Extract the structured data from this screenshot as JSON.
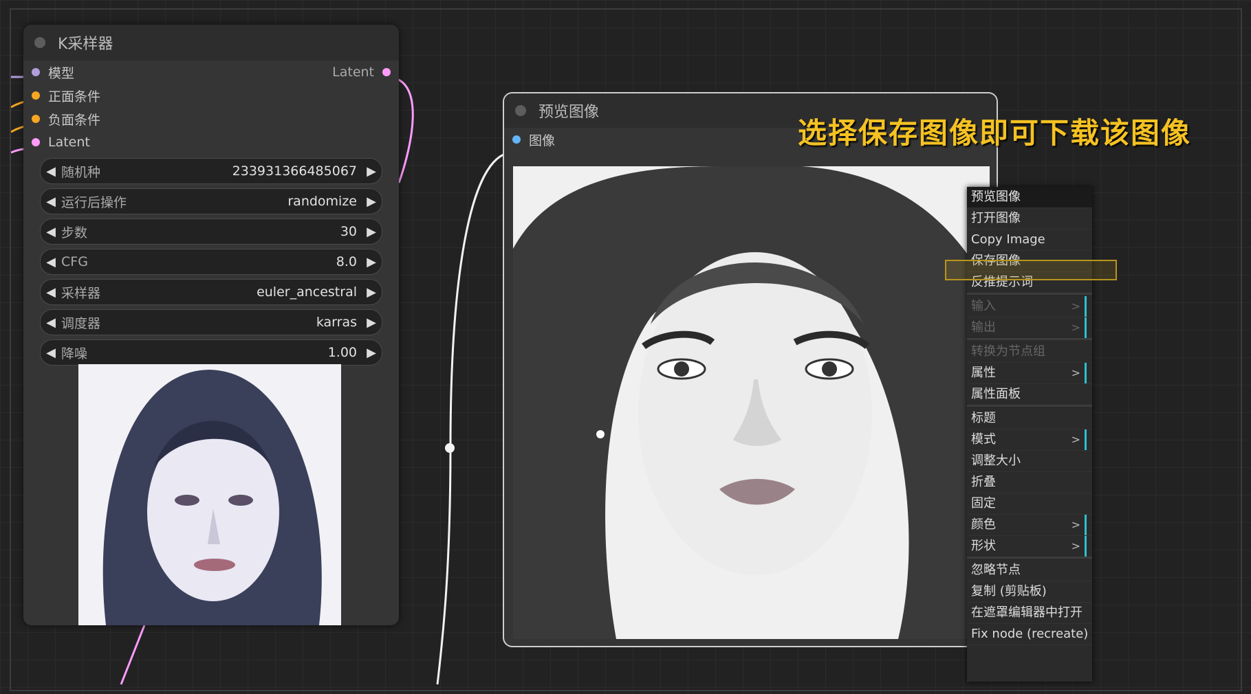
{
  "ksampler": {
    "title": "K采样器",
    "inputs": [
      {
        "label": "模型",
        "color": "#b39ddb"
      },
      {
        "label": "正面条件",
        "color": "#f5a623"
      },
      {
        "label": "负面条件",
        "color": "#f5a623"
      },
      {
        "label": "Latent",
        "color": "#ff9cf9"
      }
    ],
    "output": {
      "label": "Latent",
      "color": "#ff9cf9"
    },
    "widgets": [
      {
        "label": "随机种",
        "value": "233931366485067"
      },
      {
        "label": "运行后操作",
        "value": "randomize"
      },
      {
        "label": "步数",
        "value": "30"
      },
      {
        "label": "CFG",
        "value": "8.0"
      },
      {
        "label": "采样器",
        "value": "euler_ancestral"
      },
      {
        "label": "调度器",
        "value": "karras"
      },
      {
        "label": "降噪",
        "value": "1.00"
      }
    ]
  },
  "preview": {
    "title": "预览图像",
    "input": {
      "label": "图像",
      "color": "#64b5f6"
    }
  },
  "annotation": "选择保存图像即可下载该图像",
  "context_menu": {
    "title": "预览图像",
    "items": [
      {
        "label": "打开图像"
      },
      {
        "label": "Copy Image"
      },
      {
        "label": "保存图像"
      },
      {
        "label": "反推提示词"
      },
      {
        "label": "输入",
        "submenu": ">",
        "disabled": true
      },
      {
        "label": "输出",
        "submenu": ">",
        "disabled": true
      },
      {
        "label": "转换为节点组",
        "disabled": true
      },
      {
        "label": "属性",
        "submenu": ">"
      },
      {
        "label": "属性面板"
      },
      {
        "label": "标题"
      },
      {
        "label": "模式",
        "submenu": ">"
      },
      {
        "label": "调整大小"
      },
      {
        "label": "折叠"
      },
      {
        "label": "固定"
      },
      {
        "label": "颜色",
        "submenu": ">"
      },
      {
        "label": "形状",
        "submenu": ">"
      },
      {
        "label": "忽略节点"
      },
      {
        "label": "复制 (剪贴板)"
      },
      {
        "label": "在遮罩编辑器中打开"
      },
      {
        "label": "Fix node (recreate)"
      }
    ]
  }
}
